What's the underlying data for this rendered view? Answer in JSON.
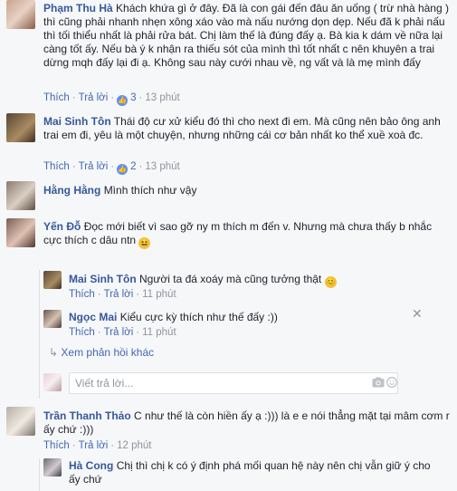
{
  "comments": [
    {
      "name": "Phạm Thu Hà",
      "text": "Khách khứa gì ở đây. Đã là con gái đến đâu ăn uống ( trừ nhà hàng ) thì cũng phải nhanh nhẹn xông xáo vào mà nấu nướng dọn dẹp. Nếu đã k phải nấu thì tối thiểu nhất là phải rửa bát. Chị làm thế là đúng đấy ạ. Bà kia k dám về nữa lại càng tốt ấy. Nếu bà ý k nhận ra thiếu sót của mình thì tốt nhất c nên khuyên a trai dừng mqh đấy lại đi ạ. Không sau này cưới nhau về, ng vất và là mẹ mình đấy",
      "like": "Thích",
      "reply": "Trả lời",
      "likes": "3",
      "time": "13 phút"
    },
    {
      "name": "Mai Sinh Tôn",
      "text": "Thái độ cư xử kiểu đó thì cho next đi em. Mà cũng nên bảo ông anh trai em đi, yêu là một chuyện, nhưng những cái cơ bản nhất ko thể xuề xoà đc.",
      "like": "Thích",
      "reply": "Trả lời",
      "likes": "2",
      "time": "13 phút"
    },
    {
      "name": "Hằng Hằng",
      "text": "Mình thích như vậy"
    },
    {
      "name": "Yến Đỗ",
      "text": "Đọc mới biết vì sao gỡ ny m thích m đến v. Nhưng mà chưa thấy b nhắc cực thích c dâu ntn"
    },
    {
      "name": "Trần Thanh Thảo",
      "text": "C như thế là còn hiền ấy ạ :))) là e e nói thẳng mặt tại mâm cơm r ấy chứ :)))",
      "like": "Thích",
      "reply": "Trả lời",
      "time": "12 phút"
    }
  ],
  "replies": [
    {
      "name": "Mai Sinh Tôn",
      "text": "Người ta đá xoáy mà cũng tưởng thật",
      "like": "Thích",
      "reply": "Trả lời",
      "time": "11 phút"
    },
    {
      "name": "Ngọc Mai",
      "text": "Kiểu cực kỳ thích như thế đấy :))",
      "like": "Thích",
      "reply": "Trả lời",
      "time": "11 phút"
    },
    {
      "name": "Hà Cong",
      "text": "Chị thì chị k có ý định phá mối quan hệ này nên chị vẫn giữ ý cho ấy chứ"
    }
  ],
  "more_replies": "Xem phản hồi khác",
  "reply_placeholder": "Viết trả lời...",
  "accent": "#365899",
  "link": "#4267b2"
}
